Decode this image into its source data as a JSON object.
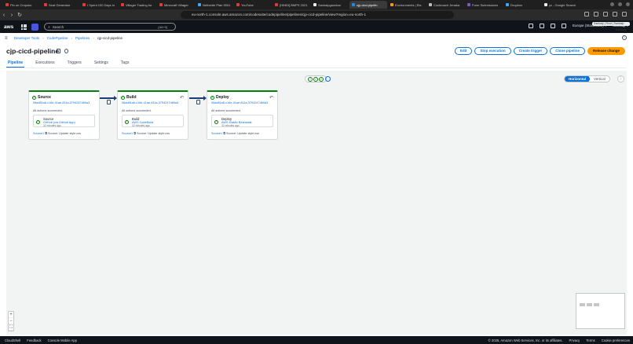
{
  "browser": {
    "tabs": [
      {
        "label": "Pin on Cropsko",
        "color": "#e53935"
      },
      {
        "label": "Seat Generator",
        "color": "#e53935"
      },
      {
        "label": "I Spent 100 Days in",
        "color": "#e53935"
      },
      {
        "label": "Villager Trading for",
        "color": "#e53935"
      },
      {
        "label": "Minecraft Villager",
        "color": "#e53935"
      },
      {
        "label": "Netherite Plan 9001",
        "color": "#42a5f5"
      },
      {
        "label": "YouTube",
        "color": "#e53935"
      },
      {
        "label": "[HINDI] BMPS 2021",
        "color": "#e53935"
      },
      {
        "label": "Sankalpgaonkar",
        "color": "#eeeeee"
      },
      {
        "label": "cjp-cicd-pipelin",
        "color": "#1e88e5",
        "active": true
      },
      {
        "label": "Environments | Ela",
        "color": "#ff9800"
      },
      {
        "label": "Cockroach Jenaka",
        "color": "#bdbdbd"
      },
      {
        "label": "Form Submissions",
        "color": "#7e57c2"
      },
      {
        "label": "Dropbox",
        "color": "#42a5f5"
      },
      {
        "label": "yx - Google Search",
        "color": "#eeeeee"
      }
    ],
    "url": "eu-north-1.console.aws.amazon.com/codesuite/codepipeline/pipelines/cjp-cicd-pipeline/view?region=eu-north-1"
  },
  "awsnav": {
    "logo": "aws",
    "search_placeholder": "Search",
    "search_hint": "[Alt+S]",
    "region": "Europe (Stockholm) ▾",
    "account": "Sankalp ▾",
    "account_popup": "Sankalp | Root | Sankalp",
    "user": "Sankalp"
  },
  "breadcrumb": [
    "Developer Tools",
    "CodePipeline",
    "Pipelines",
    "cjp-cicd-pipeline"
  ],
  "header": {
    "title": "cjp-cicd-pipeline",
    "buttons": {
      "edit": "Edit",
      "stop": "Stop execution",
      "trigger": "Create trigger",
      "clone": "Clone pipeline",
      "release": "Release change"
    }
  },
  "tabs": [
    "Pipeline",
    "Executions",
    "Triggers",
    "Settings",
    "Tags"
  ],
  "canvas": {
    "layout_options": [
      "Horizontal",
      "Vertical"
    ],
    "stages": [
      {
        "name": "Source",
        "commit": "06ad81a6-c16e-41ae-811a-3794247db9a3",
        "status": "All actions succeeded.",
        "action": {
          "name": "Source",
          "provider": "GitHub (via GitHub App)",
          "ago": "32 minutes ago"
        },
        "footer_link": "Source: Update style.css",
        "footer_prefix": "Source1"
      },
      {
        "name": "Build",
        "commit": "06ad81a6-c16e-41ae-811a-3794247db9a3",
        "status": "All actions succeeded.",
        "action": {
          "name": "Build",
          "provider": "AWS CodeBuild",
          "ago": "32 minutes ago"
        },
        "footer_link": "Source: Update style.css",
        "footer_prefix": "Source1"
      },
      {
        "name": "Deploy",
        "commit": "06ad81a6-c16e-41ae-811a-3794247db9a3",
        "status": "All actions succeeded.",
        "action": {
          "name": "Deploy",
          "provider": "AWS Elastic Beanstalk",
          "ago": "32 minutes ago"
        },
        "footer_link": "Source: Update style.css",
        "footer_prefix": "Source1"
      }
    ]
  },
  "footer": {
    "cloudshell": "CloudShell",
    "feedback": "Feedback",
    "mobile": "Console Mobile App",
    "copyright": "© 2025, Amazon Web Services, Inc. or its affiliates.",
    "privacy": "Privacy",
    "terms": "Terms",
    "cookies": "Cookie preferences"
  }
}
